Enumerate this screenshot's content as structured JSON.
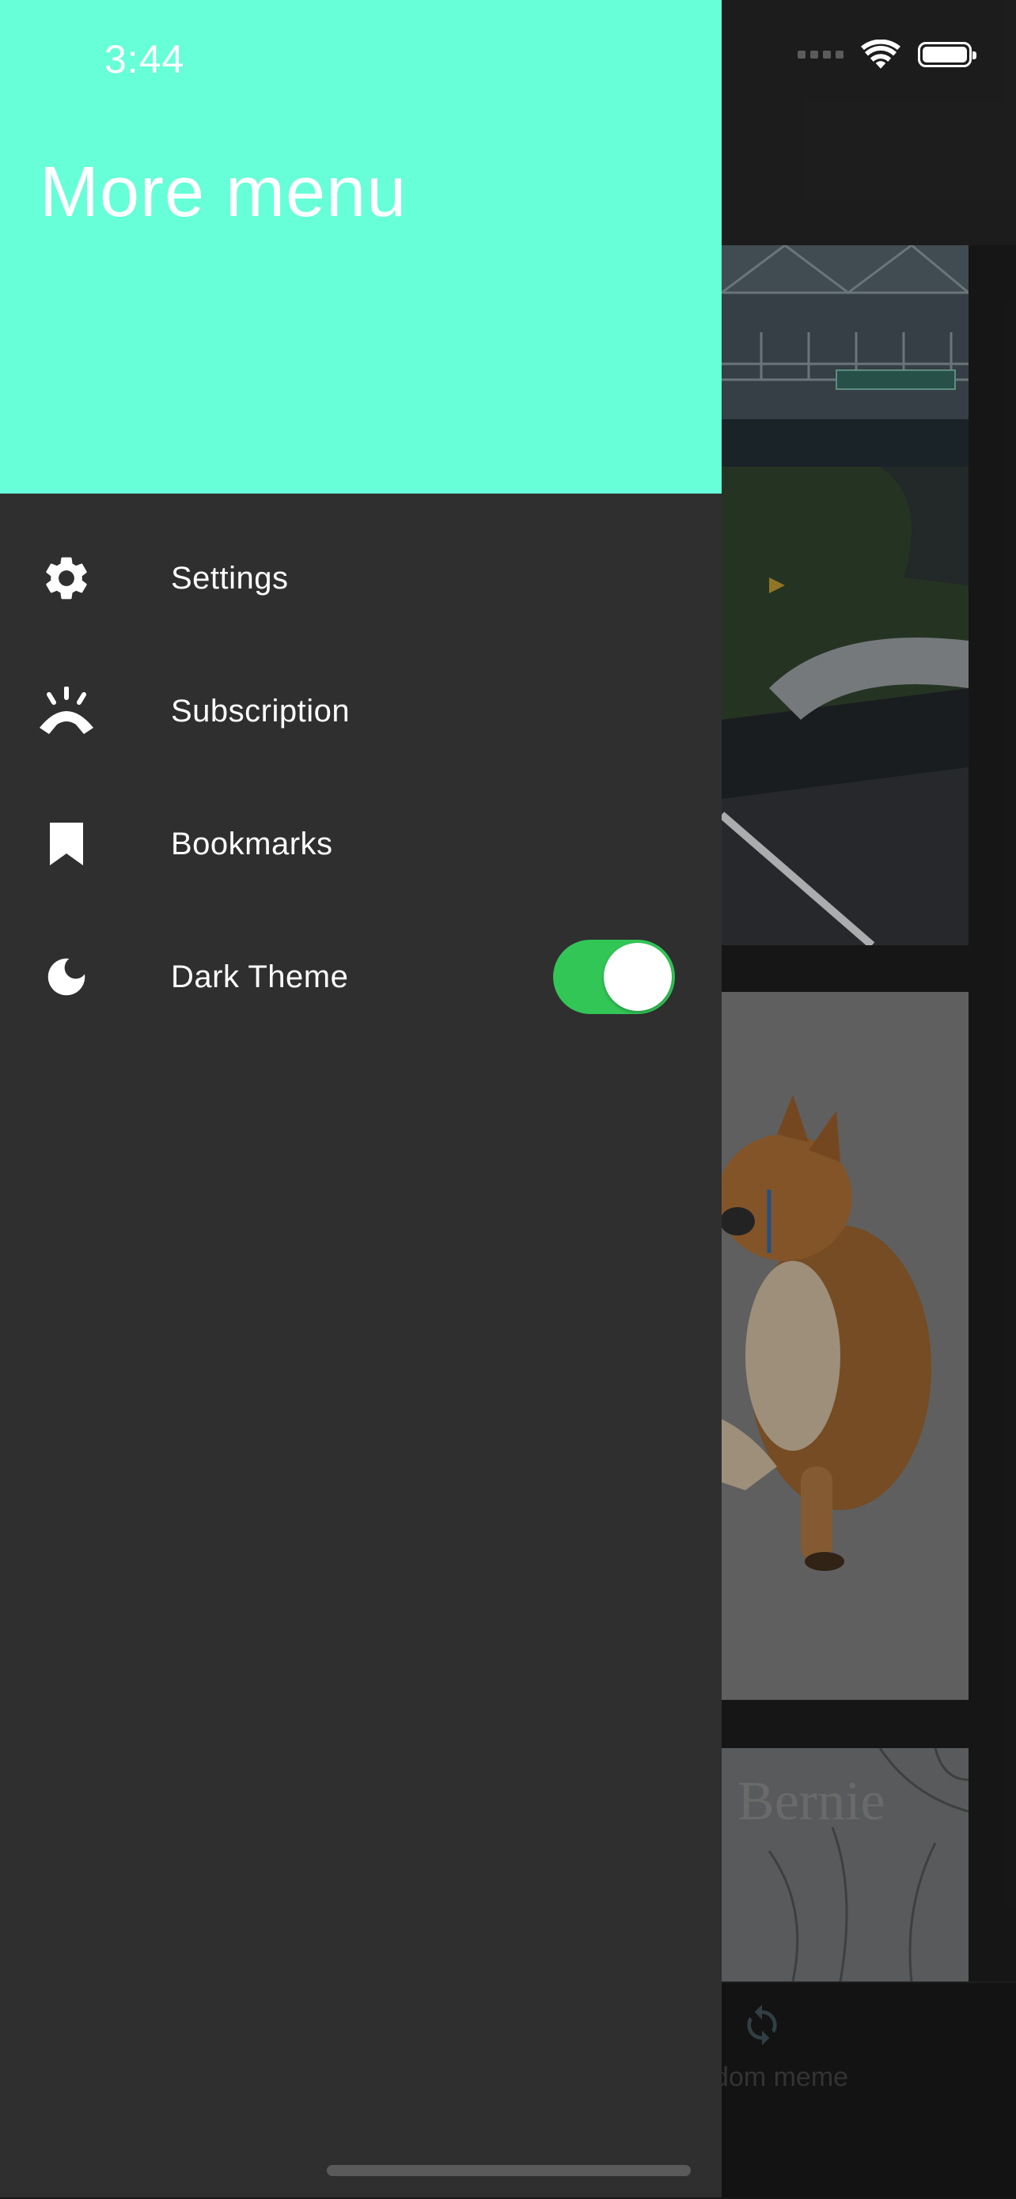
{
  "status_bar": {
    "time": "3:44"
  },
  "drawer": {
    "title": "More menu",
    "header_color": "#66ffd8",
    "items": [
      {
        "label": "Settings",
        "icon": "gear-icon"
      },
      {
        "label": "Subscription",
        "icon": "sunrise-icon"
      },
      {
        "label": "Bookmarks",
        "icon": "bookmark-icon"
      },
      {
        "label": "Dark Theme",
        "icon": "moon-icon",
        "toggle": true,
        "toggle_on": true
      }
    ],
    "toggle_color": "#32c657"
  },
  "background": {
    "image_text": "Bernie",
    "bottom_tab_label": "dom meme"
  }
}
